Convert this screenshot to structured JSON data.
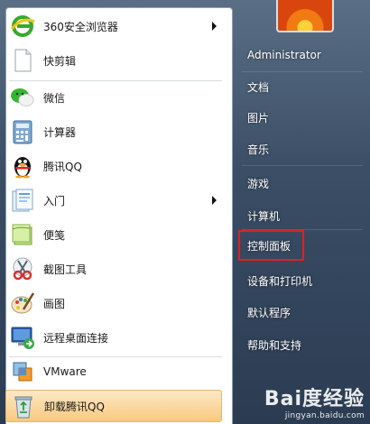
{
  "left_menu": {
    "items": [
      {
        "label": "360安全浏览器",
        "icon": "browser-360-icon",
        "has_submenu": true
      },
      {
        "label": "快剪辑",
        "icon": "blank-document-icon",
        "has_submenu": false
      },
      {
        "label": "微信",
        "icon": "wechat-icon",
        "has_submenu": false
      },
      {
        "label": "计算器",
        "icon": "calculator-icon",
        "has_submenu": false
      },
      {
        "label": "腾讯QQ",
        "icon": "qq-penguin-icon",
        "has_submenu": false
      },
      {
        "label": "入门",
        "icon": "getting-started-icon",
        "has_submenu": true
      },
      {
        "label": "便笺",
        "icon": "sticky-notes-icon",
        "has_submenu": false
      },
      {
        "label": "截图工具",
        "icon": "snipping-tool-icon",
        "has_submenu": false
      },
      {
        "label": "画图",
        "icon": "paint-palette-icon",
        "has_submenu": false
      },
      {
        "label": "远程桌面连接",
        "icon": "remote-desktop-icon",
        "has_submenu": false
      },
      {
        "label": "VMware",
        "icon": "vmware-icon",
        "has_submenu": false
      },
      {
        "label": "卸载腾讯QQ",
        "icon": "recycle-bin-icon",
        "has_submenu": false,
        "highlighted": true
      }
    ]
  },
  "right_menu": {
    "items": [
      {
        "label": "Administrator"
      },
      {
        "label": "文档"
      },
      {
        "label": "图片"
      },
      {
        "label": "音乐"
      },
      {
        "label": "游戏"
      },
      {
        "label": "计算机"
      },
      {
        "label": "控制面板",
        "annotated": true
      },
      {
        "label": "设备和打印机"
      },
      {
        "label": "默认程序"
      },
      {
        "label": "帮助和支持"
      }
    ]
  },
  "annotation_color": "#e02020",
  "highlight_color": "#fad9a2",
  "watermark": {
    "brand": "Bai度经验",
    "site": "jingyan.baidu.com"
  }
}
